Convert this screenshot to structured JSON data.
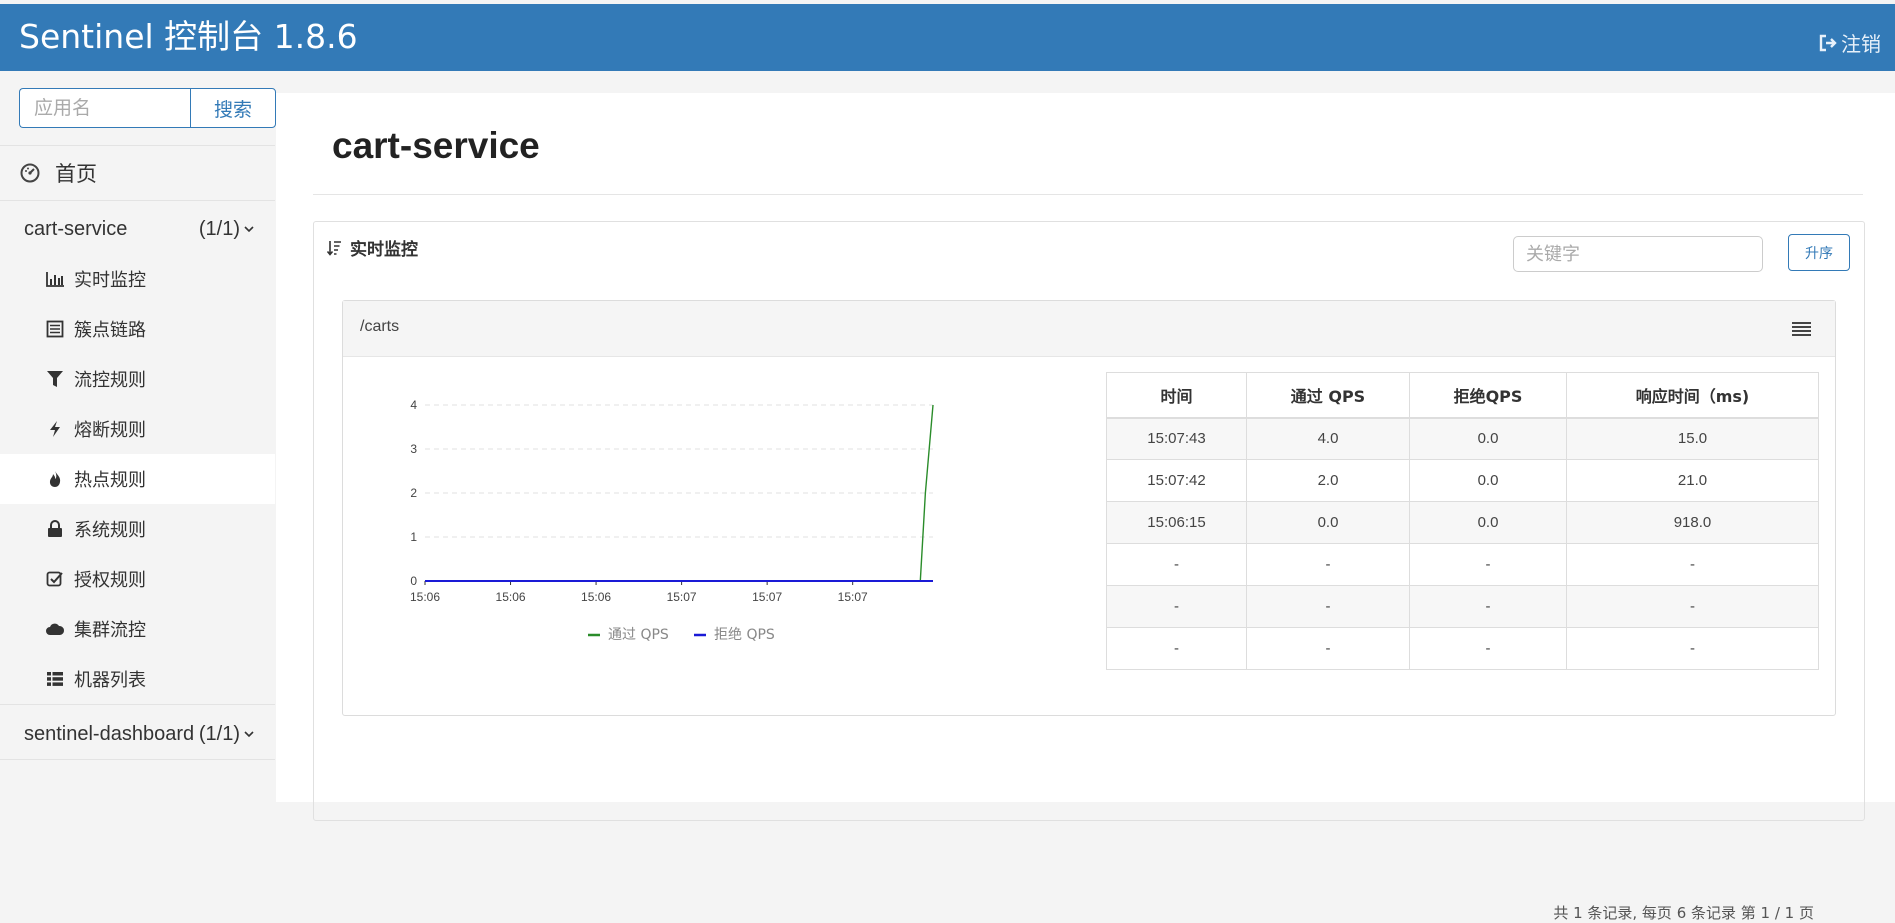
{
  "header": {
    "brand": "Sentinel 控制台 1.8.6",
    "logout_label": "注销",
    "background_color": "#337ab7"
  },
  "sidebar": {
    "search_placeholder": "应用名",
    "search_button": "搜索",
    "home_label": "首页",
    "apps": [
      {
        "name": "cart-service",
        "count": "(1/1)",
        "expanded": true,
        "items": [
          {
            "label": "实时监控",
            "icon": "bar-chart-icon"
          },
          {
            "label": "簇点链路",
            "icon": "list-alt-icon"
          },
          {
            "label": "流控规则",
            "icon": "filter-icon"
          },
          {
            "label": "熔断规则",
            "icon": "flash-icon"
          },
          {
            "label": "热点规则",
            "icon": "fire-icon"
          },
          {
            "label": "系统规则",
            "icon": "lock-icon"
          },
          {
            "label": "授权规则",
            "icon": "check-icon"
          },
          {
            "label": "集群流控",
            "icon": "cloud-icon"
          },
          {
            "label": "机器列表",
            "icon": "th-list-icon"
          }
        ]
      },
      {
        "name": "sentinel-dashboard",
        "count": "(1/1)",
        "expanded": false
      }
    ]
  },
  "main": {
    "title": "cart-service",
    "panel_title": "实时监控",
    "keyword_placeholder": "关键字",
    "sort_button": "升序",
    "resource": "/carts",
    "pagination": "共 1 条记录, 每页 6 条记录 第 1 / 1 页",
    "table": {
      "headers": [
        "时间",
        "通过 QPS",
        "拒绝QPS",
        "响应时间（ms)"
      ],
      "rows": [
        [
          "15:07:43",
          "4.0",
          "0.0",
          "15.0"
        ],
        [
          "15:07:42",
          "2.0",
          "0.0",
          "21.0"
        ],
        [
          "15:06:15",
          "0.0",
          "0.0",
          "918.0"
        ],
        [
          "-",
          "-",
          "-",
          "-"
        ],
        [
          "-",
          "-",
          "-",
          "-"
        ],
        [
          "-",
          "-",
          "-",
          "-"
        ]
      ]
    }
  },
  "chart_data": {
    "type": "line",
    "title": "",
    "xlabel": "",
    "ylabel": "",
    "x_tick_labels": [
      "15:06",
      "15:06",
      "15:06",
      "15:07",
      "15:07",
      "15:07"
    ],
    "y_ticks": [
      0,
      1,
      2,
      3,
      4
    ],
    "ylim": [
      0,
      4
    ],
    "grid": "horizontal dashed",
    "legend_position": "bottom",
    "series": [
      {
        "name": "通过 QPS",
        "color": "#2a8c2a",
        "x": [
          0,
          0.975,
          0.985,
          1.0
        ],
        "values": [
          0,
          0,
          2,
          4
        ]
      },
      {
        "name": "拒绝 QPS",
        "color": "#1a1ad6",
        "x": [
          0,
          1.0
        ],
        "values": [
          0,
          0
        ]
      }
    ]
  }
}
